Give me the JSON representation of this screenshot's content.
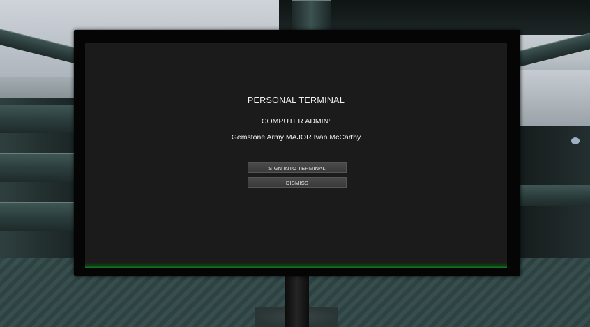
{
  "terminal": {
    "title": "PERSONAL TERMINAL",
    "admin_label": "COMPUTER ADMIN:",
    "admin_name": "Gemstone Army MAJOR Ivan McCarthy"
  },
  "buttons": {
    "sign_in_label": "SIGN INTO TERMINAL",
    "dismiss_label": "DISMISS"
  },
  "colors": {
    "screen_background": "#1b1b1b",
    "monitor_bezel": "#050505",
    "button_background": "#444444",
    "text": "#f2f2f2",
    "status_glow": "#137a1f"
  }
}
